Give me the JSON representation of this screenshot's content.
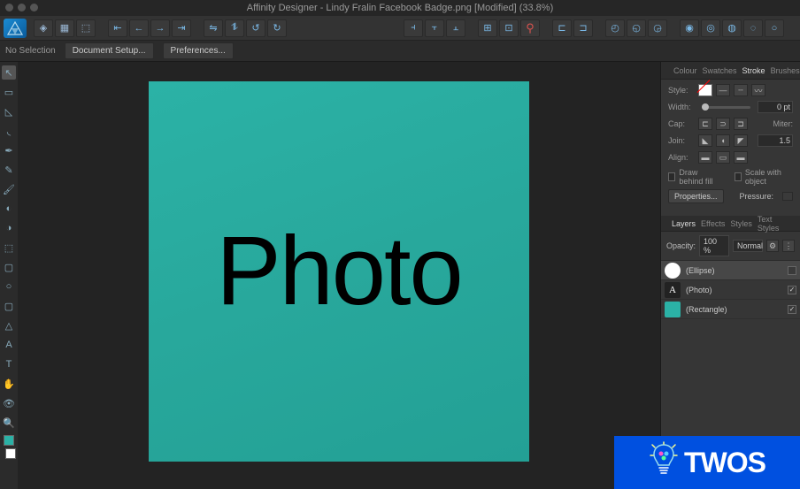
{
  "app": {
    "title": "Affinity Designer - Lindy Fralin Facebook Badge.png [Modified] (33.8%)"
  },
  "contextbar": {
    "selection": "No Selection",
    "doc_setup": "Document Setup...",
    "preferences": "Preferences..."
  },
  "canvas": {
    "text": "Photo"
  },
  "stroke_tabs": {
    "colour": "Colour",
    "swatches": "Swatches",
    "stroke": "Stroke",
    "brushes": "Brushes"
  },
  "stroke": {
    "style_label": "Style:",
    "width_label": "Width:",
    "width_value": "0 pt",
    "cap_label": "Cap:",
    "join_label": "Join:",
    "align_label": "Align:",
    "miter_label": "Miter:",
    "miter_value": "1.5",
    "draw_behind": "Draw behind fill",
    "scale": "Scale with object",
    "properties": "Properties...",
    "pressure_label": "Pressure:"
  },
  "layers_tabs": {
    "layers": "Layers",
    "effects": "Effects",
    "styles": "Styles",
    "text_styles": "Text Styles"
  },
  "layers": {
    "opacity_label": "Opacity:",
    "opacity_value": "100 %",
    "blend_mode": "Normal",
    "items": [
      {
        "name": "(Ellipse)",
        "thumb": "ellipse",
        "checked": false
      },
      {
        "name": "(Photo)",
        "thumb": "text",
        "checked": true
      },
      {
        "name": "(Rectangle)",
        "thumb": "rect",
        "checked": true
      }
    ]
  },
  "watermark": {
    "text": "TWOS"
  }
}
